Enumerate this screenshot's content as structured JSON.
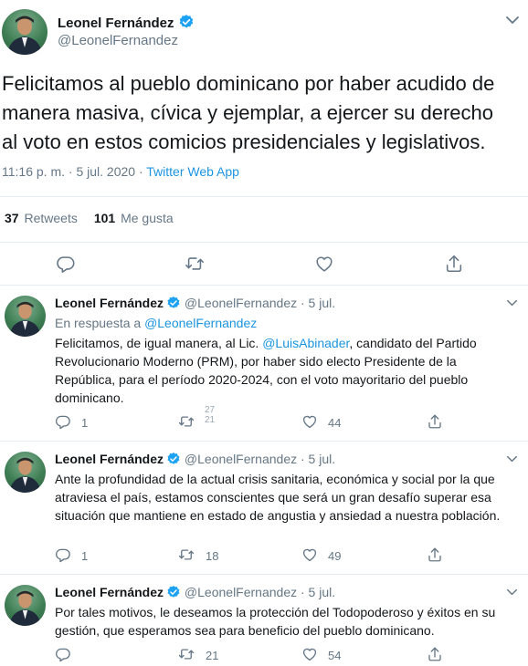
{
  "colors": {
    "link": "#1b95e0",
    "secondary": "#657786",
    "divider": "#e6ecf0",
    "verified": "#1da1f2"
  },
  "main_tweet": {
    "author_name": "Leonel Fernández",
    "author_handle": "@LeonelFernandez",
    "text": "Felicitamos al pueblo dominicano por haber acudido de\nmanera masiva, cívica y ejemplar, a ejercer su derecho\nal voto en estos comicios presidenciales y legislativos.",
    "timestamp": "11:16 p. m. · 5 jul. 2020 ·",
    "source": "Twitter Web App",
    "retweets_count": "37",
    "retweets_label": "Retweets",
    "likes_count": "101",
    "likes_label": "Me gusta",
    "icons": [
      "reply-icon",
      "retweet-icon",
      "like-icon",
      "share-icon"
    ]
  },
  "replies": [
    {
      "author_name": "Leonel Fernández",
      "author_handle": "@LeonelFernandez",
      "date": "· 5 jul.",
      "in_reply_prefix": "En respuesta a",
      "in_reply_handle": "@LeonelFernandez",
      "text_before_mention": "Felicitamos, de igual manera, al Lic. ",
      "mention": "@LuisAbinader",
      "text_after_mention": ", candidato del Partido Revolucionario Moderno (PRM), por haber sido electo Presidente de la República, para el período 2020-2024, con el voto mayoritario del pueblo dominicano.",
      "reply_count": "1",
      "retweet_count": "",
      "retweet_anim_top": "27",
      "retweet_anim_bottom": "21",
      "like_count": "44"
    },
    {
      "author_name": "Leonel Fernández",
      "author_handle": "@LeonelFernandez",
      "date": "· 5 jul.",
      "text": "Ante la profundidad de la actual crisis sanitaria, económica y social por la que atraviesa el país, estamos conscientes que será un gran desafío superar esa situación que mantiene en estado de angustia y ansiedad a nuestra población.",
      "reply_count": "1",
      "retweet_count": "18",
      "like_count": "49"
    },
    {
      "author_name": "Leonel Fernández",
      "author_handle": "@LeonelFernandez",
      "date": "· 5 jul.",
      "text": "Por tales motivos, le deseamos la protección del Todopoderoso y éxitos en su gestión, que esperamos sea para beneficio del pueblo dominicano.",
      "reply_count": "",
      "retweet_count": "21",
      "like_count": "54"
    }
  ]
}
